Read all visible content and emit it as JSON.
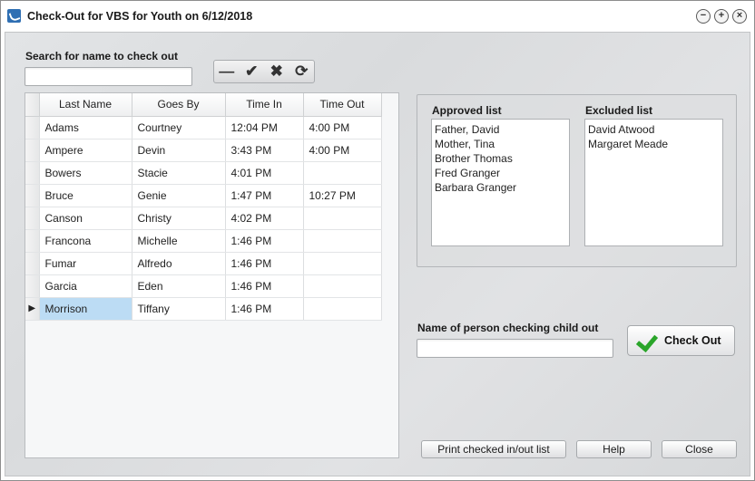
{
  "window": {
    "title": "Check-Out for VBS for Youth on 6/12/2018"
  },
  "search": {
    "label": "Search for name to check out",
    "value": ""
  },
  "toolbar": {
    "icons": [
      "minus-icon",
      "check-icon",
      "x-icon",
      "refresh-icon"
    ],
    "glyphs": [
      "—",
      "✔",
      "✖",
      "⟳"
    ]
  },
  "grid": {
    "columns": [
      "Last Name",
      "Goes By",
      "Time In",
      "Time Out"
    ],
    "rows": [
      {
        "last": "Adams",
        "goes_by": "Courtney",
        "time_in": "12:04 PM",
        "time_out": "4:00 PM"
      },
      {
        "last": "Ampere",
        "goes_by": "Devin",
        "time_in": "3:43 PM",
        "time_out": "4:00 PM"
      },
      {
        "last": "Bowers",
        "goes_by": "Stacie",
        "time_in": "4:01 PM",
        "time_out": ""
      },
      {
        "last": "Bruce",
        "goes_by": "Genie",
        "time_in": "1:47 PM",
        "time_out": "10:27 PM"
      },
      {
        "last": "Canson",
        "goes_by": "Christy",
        "time_in": "4:02 PM",
        "time_out": ""
      },
      {
        "last": "Francona",
        "goes_by": "Michelle",
        "time_in": "1:46 PM",
        "time_out": ""
      },
      {
        "last": "Fumar",
        "goes_by": "Alfredo",
        "time_in": "1:46 PM",
        "time_out": ""
      },
      {
        "last": "Garcia",
        "goes_by": "Eden",
        "time_in": "1:46 PM",
        "time_out": ""
      },
      {
        "last": "Morrison",
        "goes_by": "Tiffany",
        "time_in": "1:46 PM",
        "time_out": ""
      }
    ],
    "current_row_marker": "▶"
  },
  "approved": {
    "label": "Approved list",
    "items": [
      "Father, David",
      "Mother, Tina",
      "Brother Thomas",
      "Fred Granger",
      "Barbara Granger"
    ]
  },
  "excluded": {
    "label": "Excluded list",
    "items": [
      "David Atwood",
      "Margaret Meade"
    ]
  },
  "checker": {
    "label": "Name of person checking child out",
    "value": ""
  },
  "buttons": {
    "check_out": "Check Out",
    "print": "Print checked in/out list",
    "help": "Help",
    "close": "Close"
  },
  "window_buttons": {
    "minimize": "−",
    "maximize": "+",
    "close": "×"
  }
}
